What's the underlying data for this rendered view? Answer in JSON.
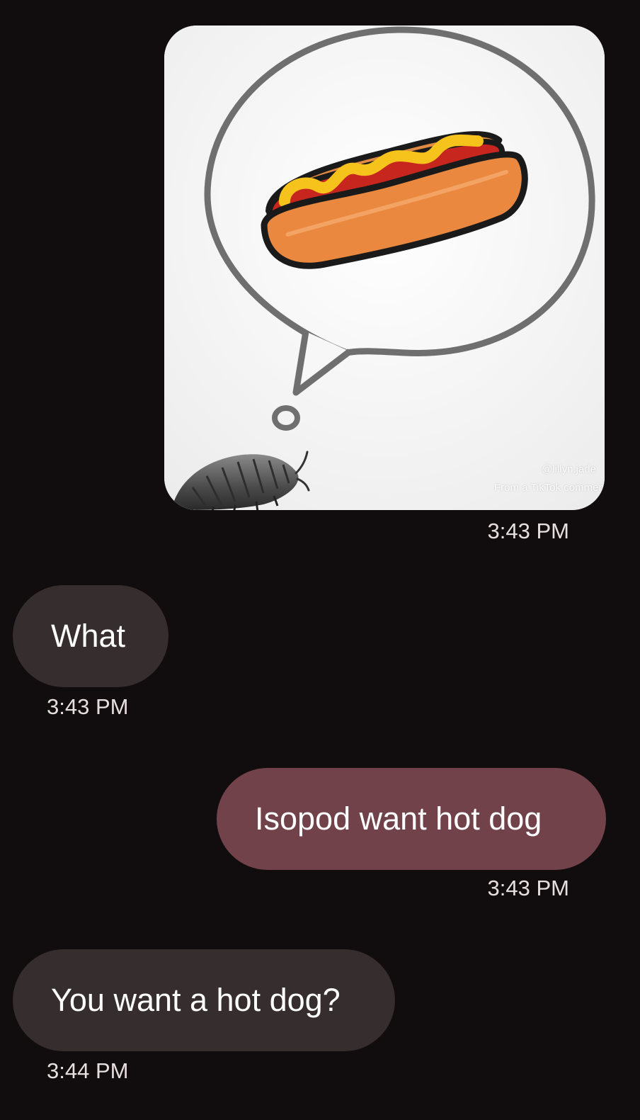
{
  "conversation": {
    "messages": [
      {
        "direction": "outgoing",
        "type": "image",
        "image_description_icon": "isopod-hotdog-thought-bubble-meme",
        "watermark_handle": "@lillyn.jade",
        "watermark_source": "From a TikTok comment",
        "timestamp": "3:43 PM"
      },
      {
        "direction": "incoming",
        "type": "text",
        "text": "What",
        "timestamp": "3:43 PM"
      },
      {
        "direction": "outgoing",
        "type": "text",
        "text": "Isopod want hot dog",
        "timestamp": "3:43 PM"
      },
      {
        "direction": "incoming",
        "type": "text",
        "text": "You want a hot dog?",
        "timestamp": "3:44 PM"
      }
    ]
  },
  "colors": {
    "background": "#110c0d",
    "incoming_bubble": "#362d2e",
    "outgoing_bubble": "#71424a",
    "timestamp_text": "#e7dedf"
  }
}
